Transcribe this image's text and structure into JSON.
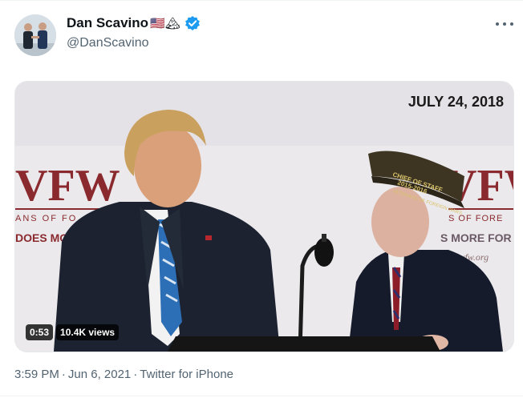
{
  "tweet": {
    "display_name": "Dan Scavino",
    "emoji": "🇺🇸🏔",
    "handle": "@DanScavino",
    "verified": true,
    "time": "3:59 PM",
    "date": "Jun 6, 2021",
    "source": "Twitter for iPhone"
  },
  "video": {
    "overlay_date": "JULY 24, 2018",
    "duration": "0:53",
    "views": "10.4K views",
    "backdrop_text": [
      "VFW",
      "ANS OF FO",
      "DOES MO",
      "VFW",
      "S OF FORE",
      "S MORE FOR",
      "w.vfw.org"
    ],
    "cap_text": [
      "CHIEF OF STAFF",
      "2015-2016",
      "VETERANS OF FOREIGN WARS"
    ]
  },
  "colors": {
    "verified_blue": "#1d9bf0",
    "secondary_text": "#536471",
    "backdrop_red": "#8a2a2e"
  }
}
